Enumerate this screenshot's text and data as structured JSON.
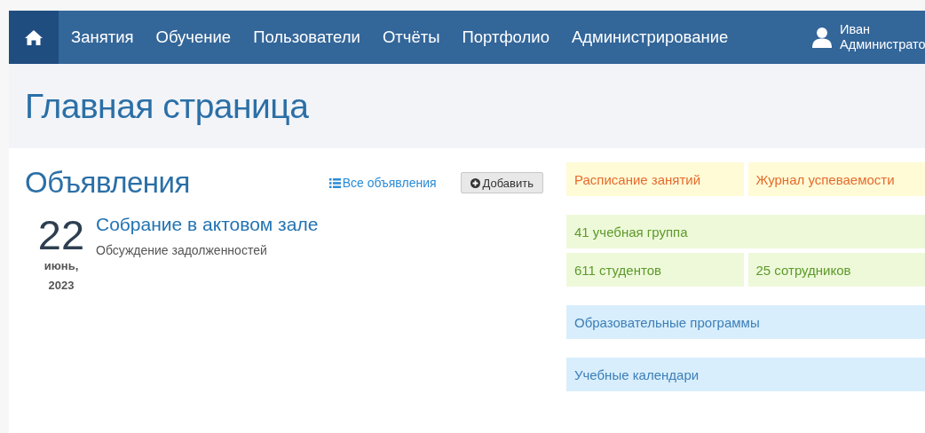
{
  "navbar": {
    "items": [
      {
        "label": "Занятия"
      },
      {
        "label": "Обучение"
      },
      {
        "label": "Пользователи"
      },
      {
        "label": "Отчёты"
      },
      {
        "label": "Портфолио"
      },
      {
        "label": "Администрирование"
      }
    ],
    "user": {
      "first_name": "Иван",
      "last_name": "Администрато"
    }
  },
  "page_title": "Главная страница",
  "announcements": {
    "title": "Объявления",
    "all_link": "Все объявления",
    "add_button": "Добавить",
    "items": [
      {
        "day": "22",
        "month": "июнь,",
        "year": "2023",
        "title": "Собрание в актовом зале",
        "text": "Обсуждение задолженностей"
      }
    ]
  },
  "tile_groups": [
    {
      "kind": "warning",
      "rows": [
        [
          "Расписание занятий",
          "Журнал успеваемости"
        ]
      ]
    },
    {
      "kind": "success",
      "rows": [
        [
          "41 учебная группа"
        ],
        [
          "611 студентов",
          "25 сотрудников"
        ]
      ]
    },
    {
      "kind": "info",
      "rows": [
        [
          "Образовательные программы"
        ]
      ]
    },
    {
      "kind": "info",
      "rows": [
        [
          "Учебные календари"
        ]
      ]
    }
  ]
}
